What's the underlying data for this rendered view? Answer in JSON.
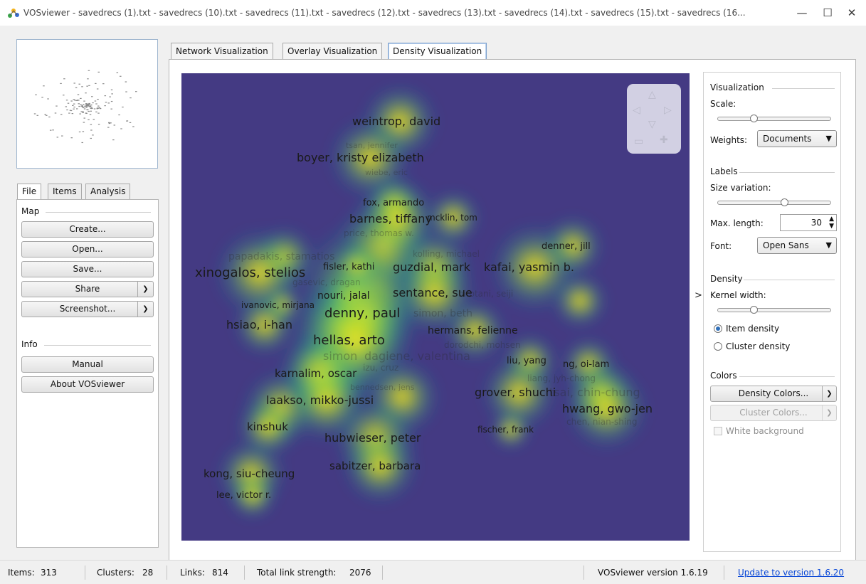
{
  "window": {
    "title": "VOSviewer - savedrecs (1).txt - savedrecs (10).txt - savedrecs (11).txt - savedrecs (12).txt - savedrecs (13).txt - savedrecs (14).txt - savedrecs (15).txt - savedrecs (16...",
    "minimize": "—",
    "maximize": "☐",
    "close": "✕"
  },
  "left_tabs": [
    "File",
    "Items",
    "Analysis"
  ],
  "left_panel": {
    "map_group": "Map",
    "buttons": {
      "create": "Create...",
      "open": "Open...",
      "save": "Save...",
      "share": "Share",
      "screenshot": "Screenshot..."
    },
    "info_group": "Info",
    "info_buttons": {
      "manual": "Manual",
      "about": "About VOSviewer"
    }
  },
  "main_tabs": [
    "Network Visualization",
    "Overlay Visualization",
    "Density Visualization"
  ],
  "active_main_tab": "Density Visualization",
  "map_labels": [
    "weintrop, david",
    "tsan, jennifer",
    "boyer, kristy elizabeth",
    "wiebe, eric",
    "fox, armando",
    "barnes, tiffany",
    "mcklin, tom",
    "price, thomas w.",
    "denner, jill",
    "kolling, michael",
    "papadakis, stamatios",
    "xinogalos, stelios",
    "fisler, kathi",
    "guzdial, mark",
    "kafai, yasmin b.",
    "gasevic, dragan",
    "nouri, jalal",
    "sentance, sue",
    "hirotani, seiji",
    "ivanovic, mirjana",
    "denny, paul",
    "simon, beth",
    "hsiao, i-han",
    "hermans, felienne",
    "hellas, arto",
    "dorodchi, mohsen",
    "simon",
    "dagiene, valentina",
    "liu, yang",
    "ng, oi-lam",
    "tsai, chin-chung",
    "liang, jyh-chong",
    "karnalim, oscar",
    "izu, cruz",
    "bennedsen, jens",
    "grover, shuchi",
    "hwang, gwo-jen",
    "chen, nian-shing",
    "laakso, mikko-jussi",
    "kinshuk",
    "hubwieser, peter",
    "fischer, frank",
    "sabitzer, barbara",
    "kong, siu-cheung",
    "lee, victor r."
  ],
  "navigation_icons": [
    "pan-up-icon",
    "pan-left-icon",
    "pan-right-icon",
    "pan-down-icon",
    "zoom-out-icon",
    "zoom-in-icon"
  ],
  "right_panel": {
    "visualization": "Visualization",
    "scale": "Scale:",
    "weights_label": "Weights:",
    "weights_value": "Documents",
    "labels": "Labels",
    "size_variation": "Size variation:",
    "max_length_label": "Max. length:",
    "max_length_value": "30",
    "font_label": "Font:",
    "font_value": "Open Sans",
    "density": "Density",
    "kernel_width": "Kernel width:",
    "item_density": "Item density",
    "cluster_density": "Cluster density",
    "colors": "Colors",
    "density_colors": "Density Colors...",
    "cluster_colors": "Cluster Colors...",
    "white_background": "White background"
  },
  "status": {
    "items_label": "Items:",
    "items": "313",
    "clusters_label": "Clusters:",
    "clusters": "28",
    "links_label": "Links:",
    "links": "814",
    "tls_label": "Total link strength:",
    "tls": "2076",
    "version": "VOSviewer version 1.6.19",
    "update": "Update to version 1.6.20"
  }
}
